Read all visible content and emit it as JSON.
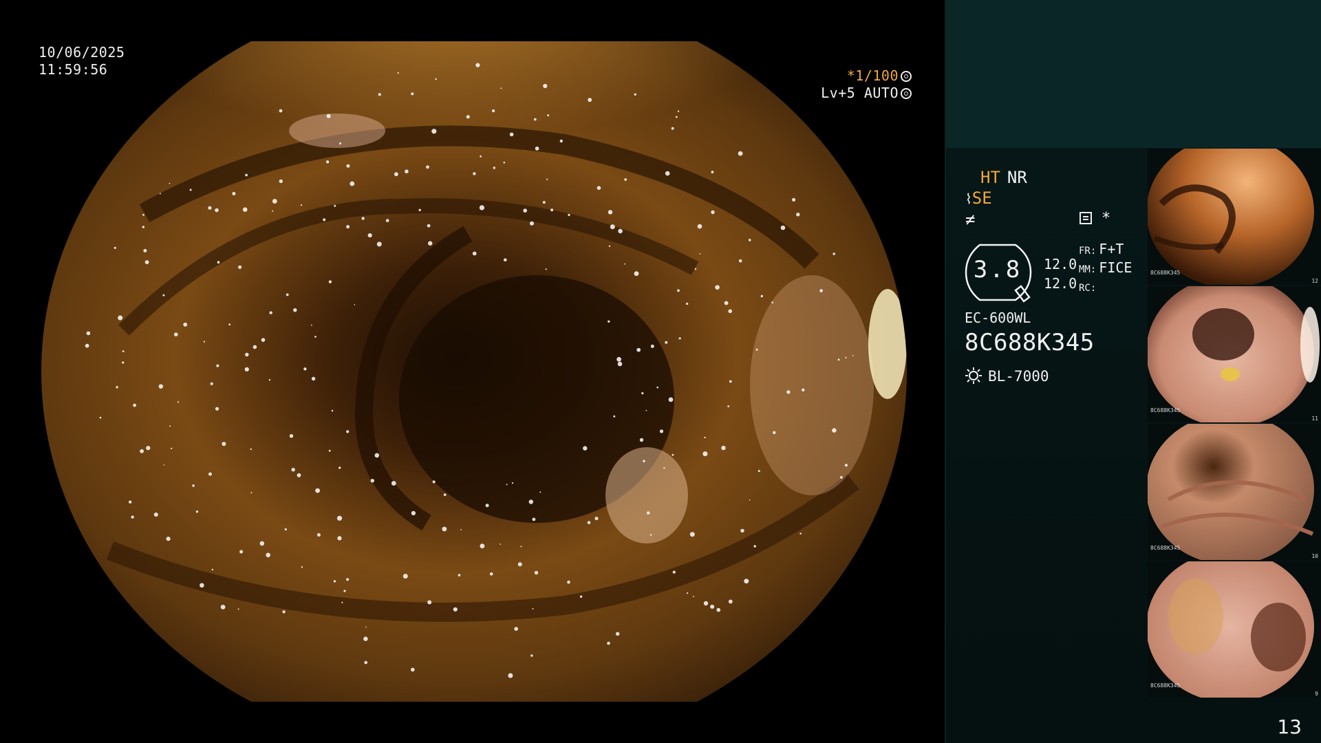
{
  "overlay": {
    "date": "10/06/2025",
    "time": "11:59:56",
    "shutter": "*1/100",
    "exposure": "Lv+5 AUTO"
  },
  "panel": {
    "ht": "HT",
    "nr": "NR",
    "se": "SE",
    "gauge_value": "3.8",
    "level_1": "12.0",
    "level_2": "12.0",
    "fr_key": "FR:",
    "fr_value": "F+T",
    "mm_key": "MM:",
    "mm_value": "FICE",
    "rc_key": "RC:",
    "scope_model": "EC-600WL",
    "serial": "8C688K345",
    "light_source": "BL-7000",
    "page_number": "13"
  },
  "thumbnails": [
    {
      "serial": "8C688K345",
      "index": "12"
    },
    {
      "serial": "8C688K345",
      "index": "11"
    },
    {
      "serial": "8C688K345",
      "index": "10"
    },
    {
      "serial": "8C688K345",
      "index": "9"
    }
  ],
  "colors": {
    "accent_orange": "#f1a83a",
    "panel_teal": "#0b2627",
    "panel_dark": "#061414"
  },
  "icons": [
    "shutter-icon",
    "auto-exposure-icon",
    "scope-tip-icon",
    "freeze-icon",
    "memory-icon",
    "asterisk-icon",
    "light-source-icon"
  ]
}
